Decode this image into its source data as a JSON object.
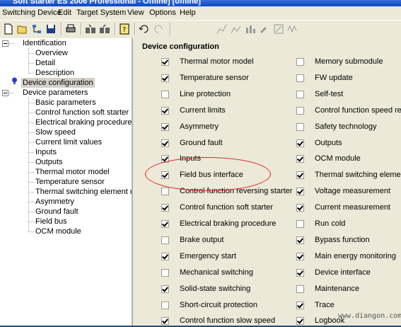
{
  "window": {
    "title": "Soft Starter ES 2006 Professional - Offline] [offline]"
  },
  "menu": [
    "Switching Device",
    "Edit",
    "Target System",
    "View",
    "Options",
    "Help"
  ],
  "toolbar": {
    "buttons": [
      "new-icon",
      "open-icon",
      "network-icon",
      "save-icon",
      "print-icon",
      "load-to-pc-icon",
      "load-to-device-icon",
      "help-icon",
      "undo-icon",
      "redo-icon",
      "chart-icon",
      "chart-icon-2",
      "bars-icon",
      "wrench-icon",
      "edit-icon",
      "waveform-icon"
    ]
  },
  "tree": {
    "identification": "Identification",
    "overview": "Overview",
    "detail": "Detail",
    "description": "Description",
    "device_configuration": "Device configuration",
    "device_parameters": "Device parameters",
    "params": [
      "Basic parameters",
      "Control function soft starter",
      "Electrical braking procedure",
      "Slow speed",
      "Current limit values",
      "Inputs",
      "Outputs",
      "Thermal motor model",
      "Temperature sensor",
      "Thermal switching element model",
      "Asymmetry",
      "Ground fault",
      "Field bus",
      "OCM module"
    ]
  },
  "panel": {
    "title": "Device configuration",
    "left": [
      {
        "label": "Thermal motor model",
        "checked": true
      },
      {
        "label": "Temperature sensor",
        "checked": true
      },
      {
        "label": "Line protection",
        "checked": false
      },
      {
        "label": "Current limits",
        "checked": true
      },
      {
        "label": "Asymmetry",
        "checked": true
      },
      {
        "label": "Ground fault",
        "checked": true
      },
      {
        "label": "Inputs",
        "checked": true
      },
      {
        "label": "Field bus interface",
        "checked": true
      },
      {
        "label": "Control function reversing starter",
        "checked": false
      },
      {
        "label": "Control function soft starter",
        "checked": true
      },
      {
        "label": "Electrical braking procedure",
        "checked": true
      },
      {
        "label": "Brake output",
        "checked": false
      },
      {
        "label": "Emergency start",
        "checked": true
      },
      {
        "label": "Mechanical switching",
        "checked": false
      },
      {
        "label": "Solid-state switching",
        "checked": true
      },
      {
        "label": "Short-circuit protection",
        "checked": false
      },
      {
        "label": "Control function slow speed",
        "checked": true
      }
    ],
    "right": [
      {
        "label": "Memory submodule",
        "checked": false
      },
      {
        "label": "FW update",
        "checked": false
      },
      {
        "label": "Self-test",
        "checked": false
      },
      {
        "label": "Control function speed regula",
        "checked": false
      },
      {
        "label": "Safety technology",
        "checked": false
      },
      {
        "label": "Outputs",
        "checked": true
      },
      {
        "label": "OCM module",
        "checked": true
      },
      {
        "label": "Thermal switching element",
        "checked": true
      },
      {
        "label": "Voltage measurement",
        "checked": true
      },
      {
        "label": "Current measurement",
        "checked": true
      },
      {
        "label": "Run cold",
        "checked": false
      },
      {
        "label": "Bypass function",
        "checked": true
      },
      {
        "label": "Main energy monitoring",
        "checked": true
      },
      {
        "label": "Device interface",
        "checked": true
      },
      {
        "label": "Maintenance",
        "checked": false
      },
      {
        "label": "Trace",
        "checked": true
      },
      {
        "label": "Logbook",
        "checked": true
      }
    ]
  },
  "watermark": "www.diangon.com",
  "colors": {
    "highlight_ellipse": "#e02020",
    "selection": "#d4d0c8"
  }
}
